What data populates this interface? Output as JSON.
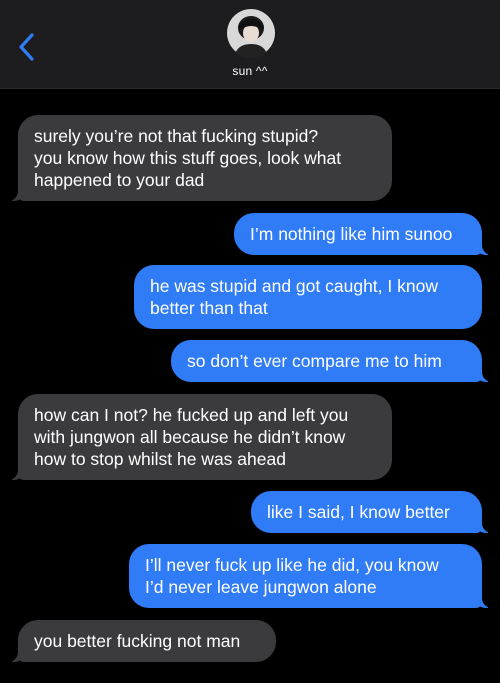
{
  "header": {
    "contact_name": "sun ^^",
    "back_icon": "chevron-left-icon",
    "accent": "#2f7cf6"
  },
  "messages": [
    {
      "direction": "incoming",
      "lines": [
        "surely you’re not that fucking stupid?",
        "you know how this stuff goes, look what",
        "happened to your dad"
      ]
    },
    {
      "direction": "outgoing",
      "lines": [
        "I’m nothing like him sunoo"
      ]
    },
    {
      "direction": "outgoing",
      "lines": [
        "he was stupid and got caught, I know",
        "better than that"
      ]
    },
    {
      "direction": "outgoing",
      "lines": [
        "so don’t ever compare me to him"
      ]
    },
    {
      "direction": "incoming",
      "lines": [
        "how can I not? he fucked up and left you",
        "with jungwon all because he didn’t know",
        "how to stop whilst he was ahead"
      ]
    },
    {
      "direction": "outgoing",
      "lines": [
        "like I said, I know better"
      ]
    },
    {
      "direction": "outgoing",
      "lines": [
        "I’ll never fuck up like he did, you know",
        "I’d never leave jungwon alone"
      ]
    },
    {
      "direction": "incoming",
      "lines": [
        "you better fucking not man"
      ]
    }
  ],
  "colors": {
    "incoming_bubble": "#3b3b3d",
    "outgoing_bubble": "#2f7cf6",
    "header_bg": "#1d1d1f"
  }
}
